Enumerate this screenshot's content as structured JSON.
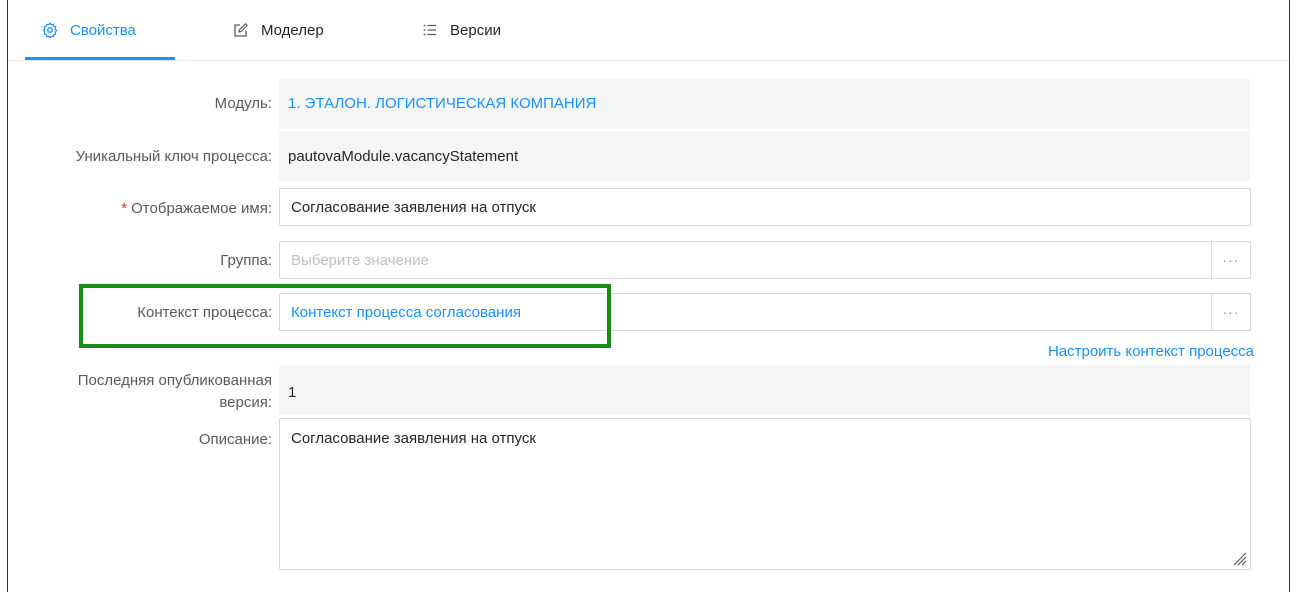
{
  "tabs": [
    {
      "label": "Свойства",
      "icon": "gear-icon",
      "active": true
    },
    {
      "label": "Моделер",
      "icon": "edit-icon",
      "active": false
    },
    {
      "label": "Версии",
      "icon": "list-icon",
      "active": false
    }
  ],
  "form": {
    "module": {
      "label": "Модуль:",
      "value": "1. ЭТАЛОН. ЛОГИСТИЧЕСКАЯ КОМПАНИЯ"
    },
    "unique_key": {
      "label": "Уникальный ключ процесса:",
      "value": "pautovaModule.vacancyStatement"
    },
    "display_name": {
      "required_mark": "*",
      "label": "Отображаемое имя:",
      "value": "Согласование заявления на отпуск"
    },
    "group": {
      "label": "Группа:",
      "placeholder": "Выберите значение",
      "button": "···"
    },
    "context": {
      "label": "Контекст процесса:",
      "value": "Контекст процесса согласования",
      "button": "···"
    },
    "configure_context_link": "Настроить контекст процесса",
    "last_version": {
      "label_line1": "Последняя опубликованная",
      "label_line2": "версия:",
      "value": "1"
    },
    "description": {
      "label": "Описание:",
      "value": "Согласование заявления на отпуск"
    }
  },
  "colors": {
    "accent": "#1890ff",
    "highlight": "#1a8a1a",
    "required": "#f5222d"
  }
}
